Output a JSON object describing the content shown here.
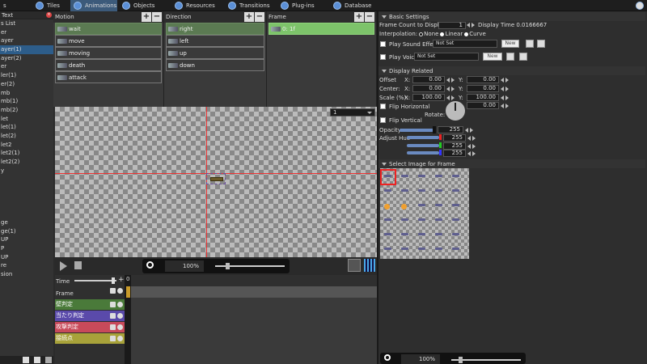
{
  "topbar": {
    "tabs": [
      {
        "label": "s",
        "icon": "scene-icon"
      },
      {
        "label": "Tiles",
        "icon": "tiles-icon"
      },
      {
        "label": "Animations",
        "icon": "animations-icon"
      },
      {
        "label": "Objects",
        "icon": "objects-icon"
      },
      {
        "label": "Resources",
        "icon": "resources-icon"
      },
      {
        "label": "Transitions",
        "icon": "transitions-icon"
      },
      {
        "label": "Plug-ins",
        "icon": "plugins-icon"
      },
      {
        "label": "Database",
        "icon": "database-icon"
      }
    ]
  },
  "left": {
    "header": "Text",
    "subheader": "s List",
    "items": [
      "er",
      "ayer",
      "ayer(1)",
      "ayer(2)",
      "er",
      "ler(1)",
      "er(2)",
      "mb",
      "mb(1)",
      "mb(2)",
      "let",
      "let(1)",
      "let(2)",
      "let2",
      "let2(1)",
      "let2(2)",
      "y",
      "",
      "",
      "",
      "",
      "",
      "ge",
      "ge(1)",
      "UP",
      "P",
      "UP",
      "re",
      "sion"
    ]
  },
  "motion": {
    "header": "Motion",
    "items": [
      "wait",
      "move",
      "moving",
      "death",
      "attack"
    ]
  },
  "direction": {
    "header": "Direction",
    "items": [
      "right",
      "left",
      "up",
      "down"
    ]
  },
  "frame": {
    "header": "Frame",
    "items": [
      "0: 1f"
    ]
  },
  "canvas": {
    "select_value": "1",
    "zoom": "100%"
  },
  "timeline": {
    "time_label": "Time",
    "frame_label": "Frame",
    "frame_index": "0",
    "tracks": [
      {
        "label": "壁判定",
        "color": "#4a7a3a"
      },
      {
        "label": "当たり判定",
        "color": "#5a4aaa"
      },
      {
        "label": "攻撃判定",
        "color": "#c84a5a"
      },
      {
        "label": "接続点",
        "color": "#a8a23a"
      }
    ]
  },
  "right": {
    "basic": {
      "title": "Basic Settings",
      "frame_count_label": "Frame Count to Display:",
      "frame_count_value": "1",
      "display_time": "Display Time 0.0166667",
      "interp_label": "Interpolation:",
      "interp_none": "None",
      "interp_linear": "Linear",
      "interp_curve": "Curve",
      "sound_label": "Play Sound Effect",
      "sound_value": "Not Set",
      "new_label": "New",
      "voice_label": "Play Voice",
      "voice_value": "Not Set"
    },
    "display": {
      "title": "Display Related",
      "offset_label": "Offset",
      "center_label": "Center:",
      "scale_label": "Scale (%):",
      "x": "X:",
      "y": "Y:",
      "offset_x": "0.00",
      "offset_y": "0.00",
      "center_x": "0.00",
      "center_y": "0.00",
      "scale_x": "100.00",
      "scale_y": "100.00",
      "flip_h": "Flip Horizontal",
      "flip_v": "Flip Vertical",
      "rotate_label": "Rotate:",
      "rotate_value": "0.00",
      "opacity_label": "Opacity",
      "opacity_value": "255",
      "hue_label": "Adjust Hue",
      "hue_r": "255",
      "hue_g": "255",
      "hue_b": "255"
    },
    "select": {
      "title": "Select Image for Frame",
      "zoom": "100%"
    }
  }
}
